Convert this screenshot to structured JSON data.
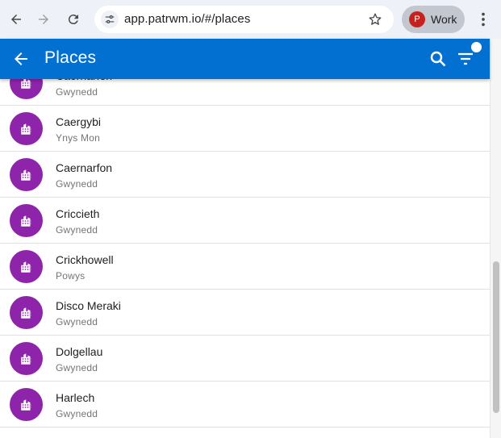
{
  "browser": {
    "url": "app.patrwm.io/#/places",
    "profile_initial": "P",
    "profile_name": "Work"
  },
  "app_bar": {
    "title": "Places"
  },
  "places": [
    {
      "name": "Caernarfon",
      "county": "Gwynedd",
      "partial": true
    },
    {
      "name": "Caergybi",
      "county": "Ynys Mon"
    },
    {
      "name": "Caernarfon",
      "county": "Gwynedd"
    },
    {
      "name": "Criccieth",
      "county": "Gwynedd"
    },
    {
      "name": "Crickhowell",
      "county": "Powys"
    },
    {
      "name": "Disco Meraki",
      "county": "Gwynedd"
    },
    {
      "name": "Dolgellau",
      "county": "Gwynedd"
    },
    {
      "name": "Harlech",
      "county": "Gwynedd"
    }
  ],
  "colors": {
    "app_bar": "#0270d0",
    "avatar_purple": "#8e24aa",
    "profile_red": "#c5221f"
  }
}
